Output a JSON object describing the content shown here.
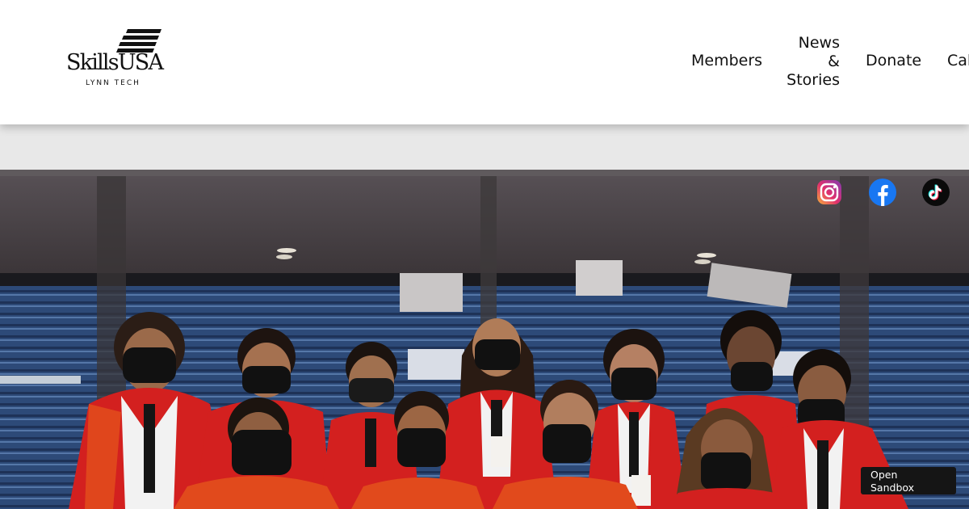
{
  "header": {
    "logo": {
      "name": "SkillsUSA",
      "sub": "LYNN TECH"
    },
    "nav": {
      "members": "Members",
      "news": [
        "News",
        "&",
        "Stories"
      ],
      "donate": "Donate",
      "cal": "Cal"
    }
  },
  "hero": {
    "image": "group-photo-students-in-red-blazers-at-stadium",
    "social": [
      {
        "name": "Instagram",
        "icon": "instagram-icon"
      },
      {
        "name": "Facebook",
        "icon": "facebook-icon"
      },
      {
        "name": "TikTok",
        "icon": "tiktok-icon"
      }
    ]
  },
  "sandbox": {
    "line1": "Open",
    "line2": "Sandbox"
  },
  "colors": {
    "blazer": "#d3201f",
    "sash": "#e14a1c",
    "band": "#e8e8e8",
    "facebook": "#1877f2"
  }
}
